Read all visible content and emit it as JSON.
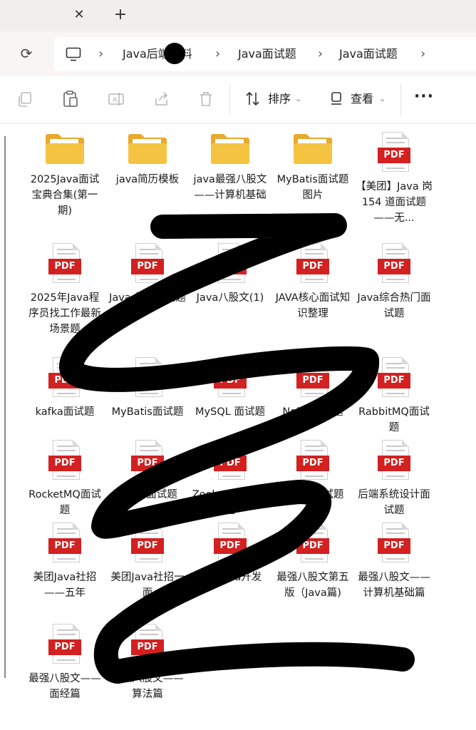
{
  "tab": {
    "close_glyph": "✕",
    "new_glyph": "+"
  },
  "address": {
    "refresh_glyph": "⟳",
    "crumbs": [
      "Java后端资料",
      "Java面试题",
      "Java面试题"
    ],
    "separator": "›"
  },
  "toolbar": {
    "sort_label": "排序",
    "view_label": "查看",
    "more_glyph": "···",
    "chevron": "⌄"
  },
  "pdf_badge": "PDF",
  "files": [
    {
      "name": "2025Java面试宝典合集(第一期)",
      "type": "folder"
    },
    {
      "name": "java简历模板",
      "type": "folder"
    },
    {
      "name": "java最强八股文——计算机基础",
      "type": "folder"
    },
    {
      "name": "MyBatis面试题图片",
      "type": "folder"
    },
    {
      "name": "【美团】Java 岗 154 道面试题——无...",
      "type": "pdf"
    },
    {
      "name": "2025年Java程序员找工作最新场景题",
      "type": "pdf"
    },
    {
      "name": "Java 并发面试题",
      "type": "pdf"
    },
    {
      "name": "Java八股文(1)",
      "type": "pdf"
    },
    {
      "name": "JAVA核心面试知识整理",
      "type": "pdf"
    },
    {
      "name": "Java综合热门面试题",
      "type": "pdf"
    },
    {
      "name": "kafka面试题",
      "type": "pdf"
    },
    {
      "name": "MyBatis面试题",
      "type": "pdf"
    },
    {
      "name": "MySQL 面试题",
      "type": "pdf"
    },
    {
      "name": "Nginx面试题",
      "type": "pdf"
    },
    {
      "name": "RabbitMQ面试题",
      "type": "pdf"
    },
    {
      "name": "RocketMQ面试题",
      "type": "pdf"
    },
    {
      "name": "seata面试题",
      "type": "pdf"
    },
    {
      "name": "Zookeeper面试题",
      "type": "pdf"
    },
    {
      "name": "分布式面试题",
      "type": "pdf"
    },
    {
      "name": "后端系统设计面试题",
      "type": "pdf"
    },
    {
      "name": "美团Java社招——五年",
      "type": "pdf"
    },
    {
      "name": "美团Java社招一面",
      "type": "pdf"
    },
    {
      "name": "小米Java开发",
      "type": "pdf"
    },
    {
      "name": "最强八股文第五版（Java篇)",
      "type": "pdf"
    },
    {
      "name": "最强八股文——计算机基础篇",
      "type": "pdf"
    },
    {
      "name": "最强八股文——面经篇",
      "type": "pdf"
    },
    {
      "name": "最强八股文——算法篇",
      "type": "pdf"
    }
  ],
  "colors": {
    "folder": "#f5c342",
    "pdf_badge": "#d32020",
    "scribble": "#000000"
  }
}
